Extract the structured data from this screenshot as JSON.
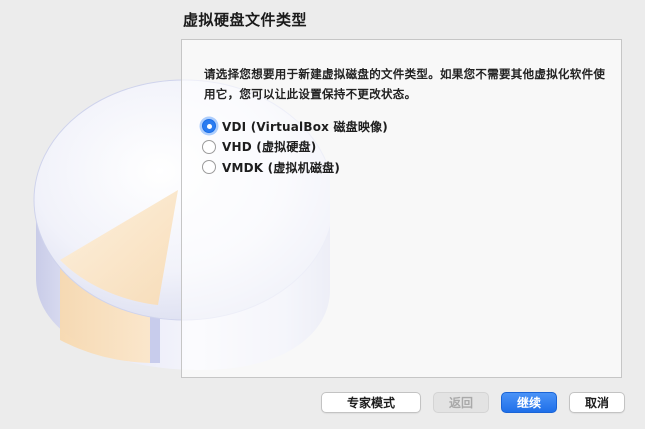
{
  "page": {
    "title": "虚拟硬盘文件类型"
  },
  "panel": {
    "description": "请选择您想要用于新建虚拟磁盘的文件类型。如果您不需要其他虚拟化软件使用它，您可以让此设置保持不更改状态。"
  },
  "options": [
    {
      "label": "VDI (VirtualBox 磁盘映像)",
      "selected": true
    },
    {
      "label": "VHD (虚拟硬盘)",
      "selected": false
    },
    {
      "label": "VMDK (虚拟机磁盘)",
      "selected": false
    }
  ],
  "buttons": {
    "expert": "专家模式",
    "back": "返回",
    "next": "继续",
    "cancel": "取消"
  },
  "colors": {
    "accent": "#2b7cf0",
    "window_bg": "#ececec"
  },
  "icons": {
    "illustration": "disk-cylinder-icon"
  }
}
